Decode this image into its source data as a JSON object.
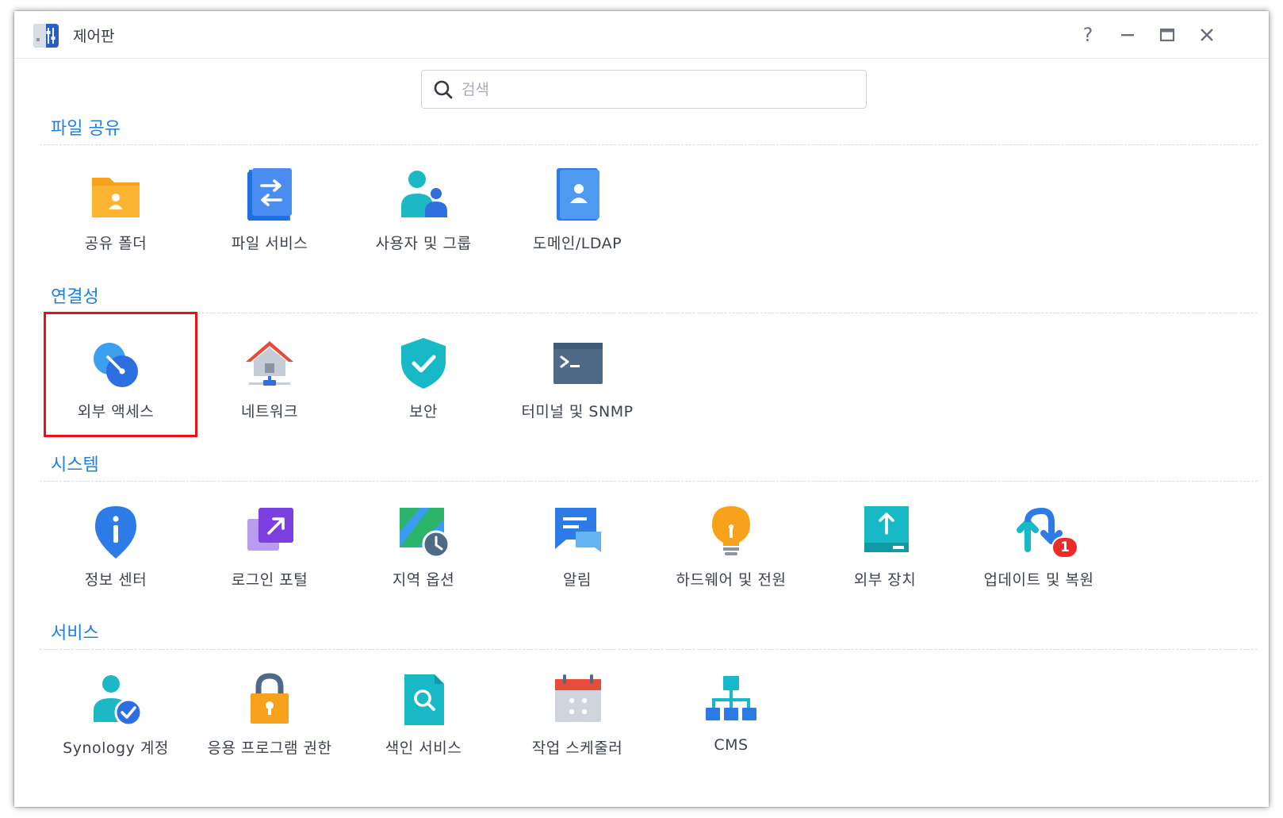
{
  "window": {
    "title": "제어판",
    "help_label": "?"
  },
  "search": {
    "placeholder": "검색",
    "value": ""
  },
  "sections": [
    {
      "title": "파일 공유",
      "items": [
        {
          "label": "공유 폴더",
          "icon": "shared-folder-icon"
        },
        {
          "label": "파일 서비스",
          "icon": "file-services-icon"
        },
        {
          "label": "사용자 및 그룹",
          "icon": "users-groups-icon"
        },
        {
          "label": "도메인/LDAP",
          "icon": "domain-ldap-icon"
        }
      ]
    },
    {
      "title": "연결성",
      "items": [
        {
          "label": "외부 액세스",
          "icon": "external-access-icon",
          "highlighted": true
        },
        {
          "label": "네트워크",
          "icon": "network-icon"
        },
        {
          "label": "보안",
          "icon": "security-shield-icon"
        },
        {
          "label": "터미널 및 SNMP",
          "icon": "terminal-icon"
        }
      ]
    },
    {
      "title": "시스템",
      "items": [
        {
          "label": "정보 센터",
          "icon": "info-center-icon"
        },
        {
          "label": "로그인 포털",
          "icon": "login-portal-icon"
        },
        {
          "label": "지역 옵션",
          "icon": "regional-options-icon"
        },
        {
          "label": "알림",
          "icon": "notification-icon"
        },
        {
          "label": "하드웨어 및 전원",
          "icon": "hardware-power-icon"
        },
        {
          "label": "외부 장치",
          "icon": "external-devices-icon"
        },
        {
          "label": "업데이트 및 복원",
          "icon": "update-restore-icon",
          "badge": "1"
        }
      ]
    },
    {
      "title": "서비스",
      "items": [
        {
          "label": "Synology 계정",
          "icon": "synology-account-icon"
        },
        {
          "label": "응용 프로그램 권한",
          "icon": "app-privileges-icon"
        },
        {
          "label": "색인 서비스",
          "icon": "indexing-service-icon"
        },
        {
          "label": "작업 스케줄러",
          "icon": "task-scheduler-icon"
        },
        {
          "label": "CMS",
          "icon": "cms-icon"
        }
      ]
    }
  ],
  "colors": {
    "accent": "#1f7fe0",
    "highlight_border": "#e8101a",
    "badge": "#ec2b2b"
  }
}
